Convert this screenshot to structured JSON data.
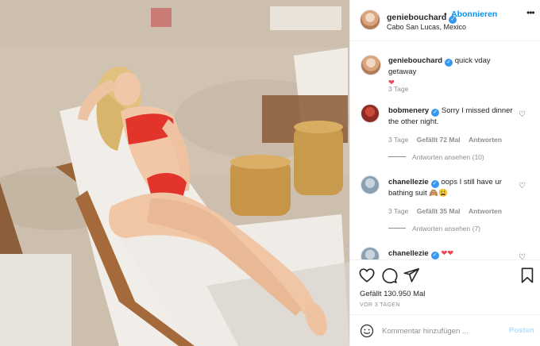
{
  "post": {
    "image_alt": "Woman in red bikini lounging on a beach chair",
    "author": "geniebouchard",
    "follow_label": "Abonnieren",
    "separator": "•",
    "location": "Cabo San Lucas, Mexico",
    "more_icon": "more-horizontal-icon"
  },
  "caption": {
    "username": "geniebouchard",
    "text": "quick vday getaway",
    "emoji": "❤",
    "time": "3 Tage"
  },
  "comments": [
    {
      "username": "bobmenery",
      "text": "Sorry I missed dinner the other night.",
      "time": "3 Tage",
      "likes": "Gefällt 72 Mal",
      "reply_label": "Antworten",
      "view_replies": "Antworten ansehen (10)"
    },
    {
      "username": "chanellezie",
      "text": "oops I still have ur bathing suit",
      "emoji": "🙈😩",
      "time": "3 Tage",
      "likes": "Gefällt 35 Mal",
      "reply_label": "Antworten",
      "view_replies": "Antworten ansehen (7)"
    },
    {
      "username": "chanellezie",
      "text": "",
      "emoji": "❤❤"
    }
  ],
  "actions": {
    "like_icon": "heart-icon",
    "comment_icon": "comment-icon",
    "share_icon": "send-icon",
    "save_icon": "bookmark-icon",
    "likes": "Gefällt 130.950 Mal",
    "posted_ago": "VOR 3 TAGEN"
  },
  "comment_input": {
    "placeholder": "Kommentar hinzufügen ...",
    "post_label": "Posten"
  },
  "colors": {
    "accent": "#0095f6",
    "verified": "#3897f0",
    "heart": "#ed4956",
    "muted": "#8e8e8e"
  }
}
